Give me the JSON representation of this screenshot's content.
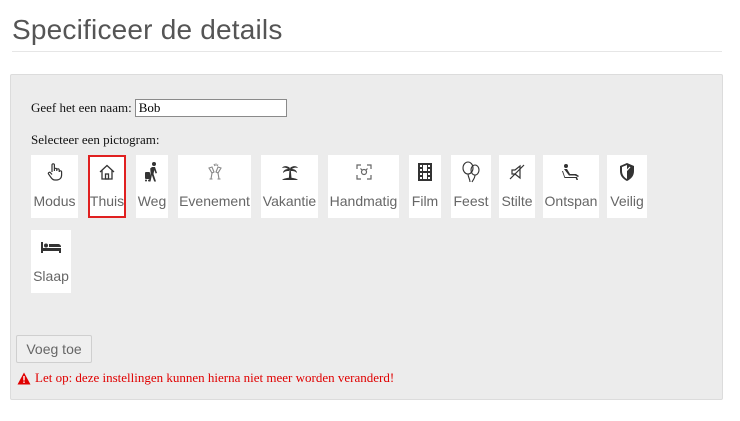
{
  "header": {
    "title": "Specificeer de details"
  },
  "form": {
    "name_label": "Geef het een naam:",
    "name_value": "Bob",
    "icon_prompt": "Selecteer een pictogram:",
    "icons": [
      {
        "label": "Modus",
        "icon": "hand-pointer-icon"
      },
      {
        "label": "Thuis",
        "icon": "home-icon",
        "selected": true
      },
      {
        "label": "Weg",
        "icon": "traveler-icon"
      },
      {
        "label": "Evenement",
        "icon": "champagne-glasses-icon"
      },
      {
        "label": "Vakantie",
        "icon": "palm-island-icon"
      },
      {
        "label": "Handmatig",
        "icon": "manual-focus-icon"
      },
      {
        "label": "Film",
        "icon": "film-strip-icon"
      },
      {
        "label": "Feest",
        "icon": "balloons-icon"
      },
      {
        "label": "Stilte",
        "icon": "mute-speaker-icon"
      },
      {
        "label": "Ontspan",
        "icon": "relax-chair-icon"
      },
      {
        "label": "Veilig",
        "icon": "shield-icon"
      },
      {
        "label": "Slaap",
        "icon": "bed-icon"
      }
    ],
    "add_button_label": "Voeg toe",
    "warning_text": "Let op: deze instellingen kunnen hierna niet meer worden veranderd!"
  },
  "colors": {
    "selected_border": "#e02020",
    "warning": "#e00000",
    "panel_bg": "#ececec"
  }
}
